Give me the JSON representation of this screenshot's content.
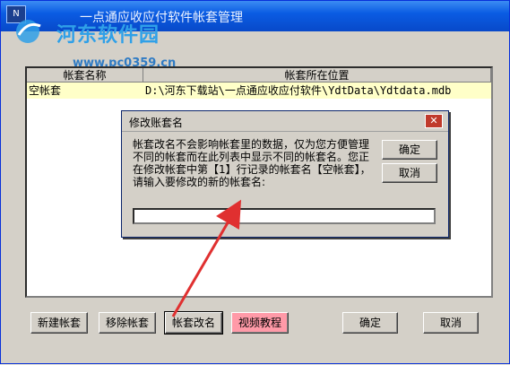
{
  "window": {
    "title": "一点通应收应付软件帐套管理"
  },
  "watermark": {
    "text": "河东软件园",
    "url": "www.pc0359.cn"
  },
  "table": {
    "columns": [
      "帐套名称",
      "帐套所在位置"
    ],
    "rows": [
      {
        "name": "空帐套",
        "path": "D:\\河东下载站\\一点通应收应付软件\\YdtData\\Ydtdata.mdb"
      }
    ]
  },
  "buttons": {
    "new": "新建帐套",
    "remove": "移除帐套",
    "rename": "帐套改名",
    "video": "视频教程",
    "ok": "确定",
    "cancel": "取消"
  },
  "dialog": {
    "title": "修改账套名",
    "message": "帐套改名不会影响帐套里的数据，仅为您方便管理不同的帐套而在此列表中显示不同的帐套名。您正在修改帐套中第【1】行记录的帐套名【空帐套】，请输入要修改的新的帐套名:",
    "ok": "确定",
    "cancel": "取消",
    "input_value": ""
  },
  "colors": {
    "titlebar": "#0a5ce3",
    "row_highlight": "#ffffc8",
    "video_button": "#ff9aa8",
    "arrow": "#e03030"
  }
}
